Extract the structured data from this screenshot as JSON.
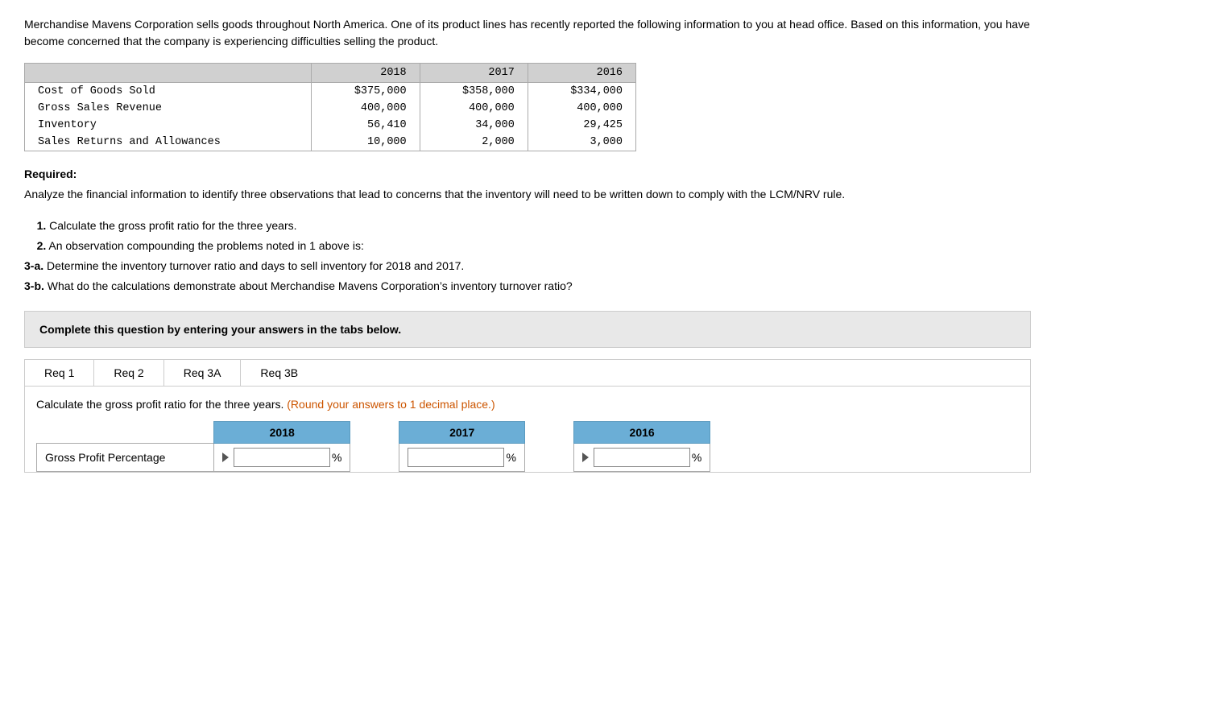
{
  "intro": {
    "text": "Merchandise Mavens Corporation sells goods throughout North America. One of its product lines has recently reported the following information to you at head office. Based on this information, you have become concerned that the company is experiencing difficulties selling the product."
  },
  "data_table": {
    "headers": [
      "",
      "2018",
      "2017",
      "2016"
    ],
    "rows": [
      {
        "label": "Cost of Goods Sold",
        "2018": "$375,000",
        "2017": "$358,000",
        "2016": "$334,000"
      },
      {
        "label": "Gross Sales Revenue",
        "2018": "400,000",
        "2017": "400,000",
        "2016": "400,000"
      },
      {
        "label": "Inventory",
        "2018": "56,410",
        "2017": "34,000",
        "2016": "29,425"
      },
      {
        "label": "Sales Returns and Allowances",
        "2018": "10,000",
        "2017": "2,000",
        "2016": "3,000"
      }
    ]
  },
  "required": {
    "label": "Required:",
    "text": "Analyze the financial information to identify three observations that lead to concerns that the inventory will need to be written down to comply with the LCM/NRV rule."
  },
  "steps": [
    {
      "number": "1.",
      "bold": true,
      "text": " Calculate the gross profit ratio for the three years."
    },
    {
      "number": "2.",
      "bold": true,
      "text": " An observation compounding the problems noted in 1 above is:"
    },
    {
      "number": "3-a.",
      "bold": true,
      "text": " Determine the inventory turnover ratio and days to sell inventory for 2018 and 2017."
    },
    {
      "number": "3-b.",
      "bold": true,
      "text": " What do the calculations demonstrate about Merchandise Mavens Corporation’s inventory turnover ratio?"
    }
  ],
  "complete_box": {
    "text": "Complete this question by entering your answers in the tabs below."
  },
  "tabs": [
    {
      "id": "req1",
      "label": "Req 1",
      "active": true
    },
    {
      "id": "req2",
      "label": "Req 2",
      "active": false
    },
    {
      "id": "req3a",
      "label": "Req 3A",
      "active": false
    },
    {
      "id": "req3b",
      "label": "Req 3B",
      "active": false
    }
  ],
  "tab_content": {
    "instruction_normal": "Calculate the gross profit ratio for the three years. ",
    "instruction_colored": "(Round your answers to 1 decimal place.)",
    "answer_table": {
      "headers": [
        "",
        "2018",
        "2017",
        "2016"
      ],
      "rows": [
        {
          "label": "Gross Profit Percentage",
          "2018_value": "",
          "2017_value": "",
          "2016_value": "",
          "pct_label": "%"
        }
      ]
    }
  }
}
